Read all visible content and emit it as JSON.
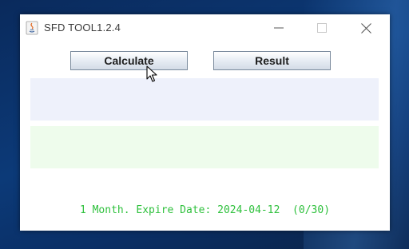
{
  "window": {
    "title": "SFD TOOL1.2.4"
  },
  "titlebar_controls": {
    "minimize": "minimize-icon",
    "maximize": "maximize-icon",
    "close": "close-icon"
  },
  "buttons": {
    "calculate_label": "Calculate",
    "result_label": "Result"
  },
  "panels": {
    "calc_output": "",
    "result_output": ""
  },
  "status": {
    "text": "1 Month. Expire Date: 2024-04-12  (0/30)"
  },
  "colors": {
    "status_text": "#2fc13d",
    "panel_calc": "#eef1fb",
    "panel_result": "#eefcec",
    "desktop": "#0c3a78"
  }
}
